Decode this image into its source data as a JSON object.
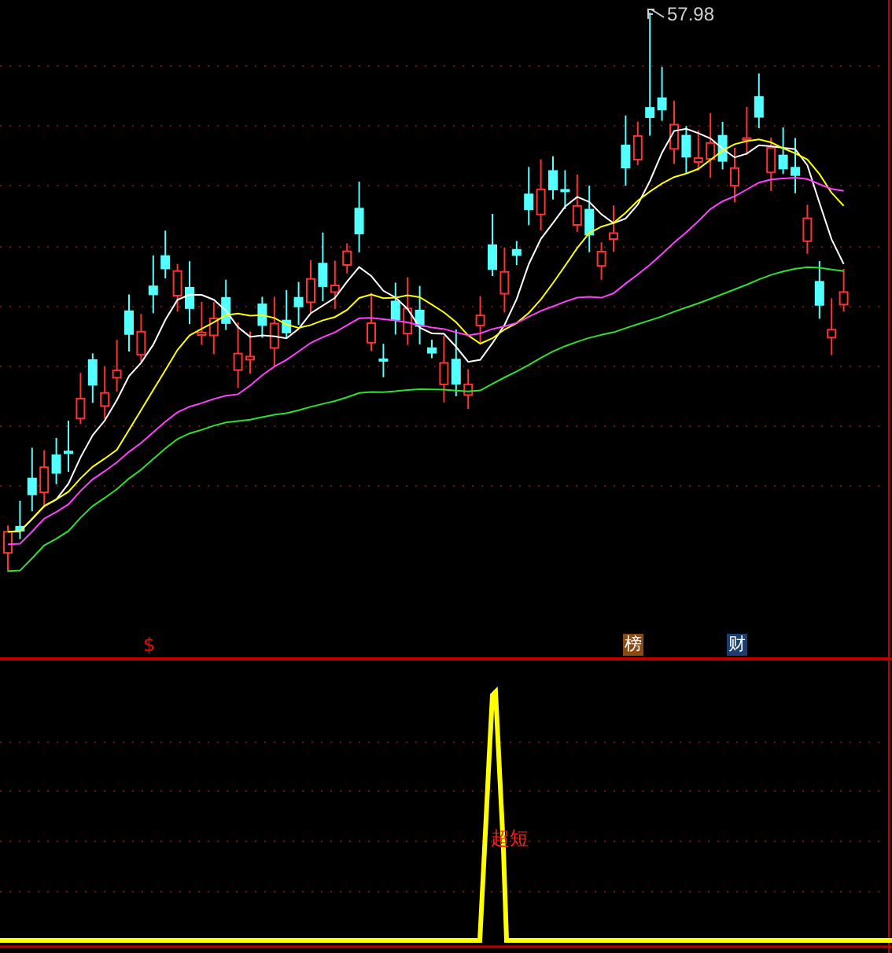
{
  "chart": {
    "high_label": "57.98",
    "markers": [
      {
        "text": "$",
        "kind": "text",
        "color": "#ff0000"
      },
      {
        "text": "榜",
        "kind": "badge",
        "color": "#8b4a12"
      },
      {
        "text": "财",
        "kind": "badge",
        "color": "#1b3f6e"
      }
    ]
  },
  "indicator": {
    "label": "超短"
  }
}
